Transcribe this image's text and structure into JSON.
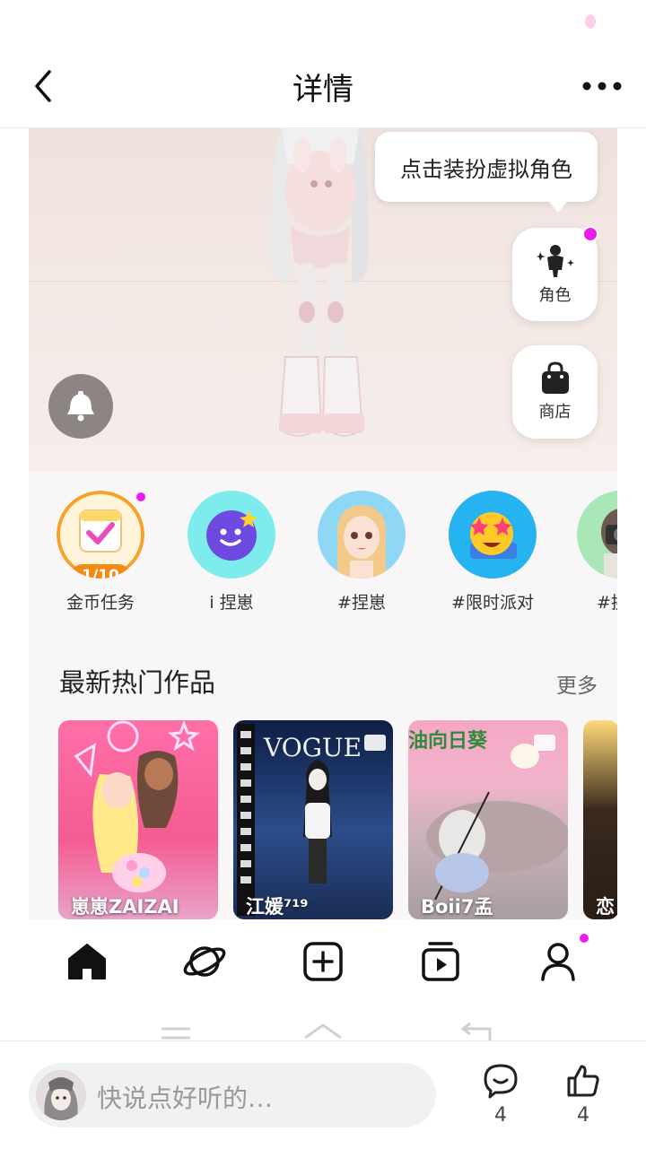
{
  "header": {
    "title": "详情"
  },
  "hero": {
    "tooltip": "点击装扮虚拟角色",
    "role_label": "角色",
    "shop_label": "商店"
  },
  "shortcuts": [
    {
      "label": "金币任务",
      "badge": "1/10"
    },
    {
      "label": "i 捏崽"
    },
    {
      "label": "#捏崽"
    },
    {
      "label": "#限时派对"
    },
    {
      "label": "#换装"
    }
  ],
  "hot": {
    "title": "最新热门作品",
    "more": "更多",
    "works": [
      {
        "caption": "崽崽ZAIZAI"
      },
      {
        "caption": "江媛⁷¹⁹",
        "overlay": "VOGUE"
      },
      {
        "caption": "Boii7孟",
        "overlay": "油向日葵"
      },
      {
        "caption": "恋"
      }
    ]
  },
  "nav": [
    "home-icon",
    "planet-icon",
    "add-icon",
    "video-icon",
    "profile-icon"
  ],
  "comment": {
    "placeholder": "快说点好听的…"
  },
  "actions": {
    "comments": "4",
    "likes": "4"
  },
  "colors": {
    "accent_pink": "#e91df0",
    "badge_orange": "#f58a13",
    "ink": "#111111"
  }
}
